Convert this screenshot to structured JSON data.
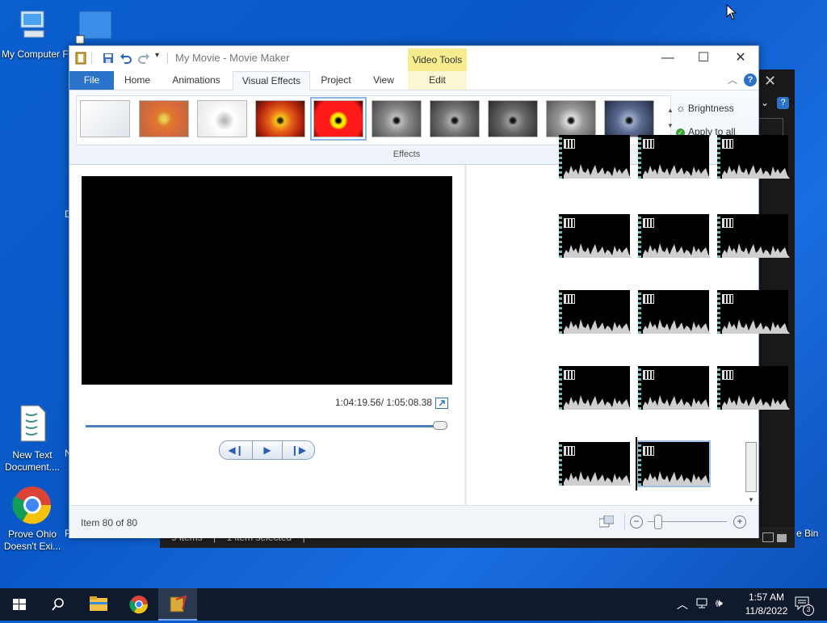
{
  "desktop": {
    "icons": [
      {
        "label": "My Computer F"
      },
      {
        "label": "New Text Document...."
      },
      {
        "label": "Prove Ohio Doesn't Exi..."
      },
      {
        "label": "e Bin"
      }
    ],
    "partial_letter_d": "D",
    "partial_letter_n": "N",
    "partial_letter_p": "P"
  },
  "background_window": {
    "status_items": "9 items",
    "status_selected": "1 item selected",
    "sep": "|"
  },
  "movie_maker": {
    "title": "My Movie - Movie Maker",
    "context_tab_group": "Video Tools",
    "tabs": [
      "File",
      "Home",
      "Animations",
      "Visual Effects",
      "Project",
      "View",
      "Edit"
    ],
    "active_tab": "Visual Effects",
    "ribbon": {
      "brightness_label": "Brightness",
      "apply_all_label": "Apply to all",
      "group_label": "Effects"
    },
    "player": {
      "timecode": "1:04:19.56/ 1:05:08.38",
      "progress": 0.985
    },
    "zoom_level": 0.1,
    "status_text": "Item 80 of 80"
  },
  "taskbar": {
    "time": "1:57 AM",
    "date": "11/8/2022",
    "notification_count": "3"
  }
}
